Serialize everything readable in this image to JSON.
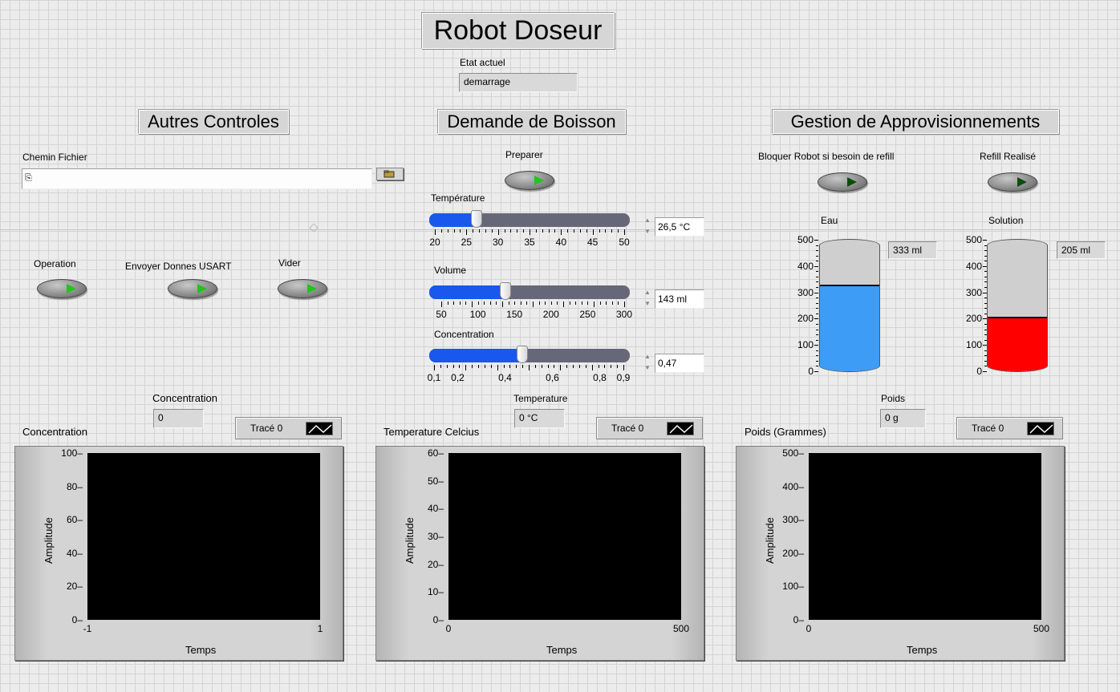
{
  "title": "Robot Doseur",
  "state": {
    "label": "Etat actuel",
    "value": "demarrage"
  },
  "sections": {
    "left": "Autres Controles",
    "center": "Demande de Boisson",
    "right": "Gestion de Approvisionnements"
  },
  "file": {
    "label": "Chemin Fichier",
    "value": "",
    "path_glyph": "⎘",
    "browse_icon": "folder-open-icon"
  },
  "buttons": {
    "operation": "Operation",
    "envoyer": "Envoyer Donnes USART",
    "vider": "Vider",
    "preparer": "Preparer",
    "bloquer": "Bloquer Robot si besoin de refill",
    "refill": "Refill Realisé"
  },
  "sliders": {
    "temperature": {
      "label": "Température",
      "value": 26.5,
      "min": 20,
      "max": 50,
      "display": "26,5 °C",
      "ticks": [
        "20",
        "25",
        "30",
        "35",
        "40",
        "45",
        "50"
      ]
    },
    "volume": {
      "label": "Volume",
      "value": 143,
      "min": 50,
      "max": 300,
      "display": "143 ml",
      "ticks": [
        "50",
        "100",
        "150",
        "200",
        "250",
        "300"
      ]
    },
    "concentration": {
      "label": "Concentration",
      "value": 0.47,
      "min": 0.1,
      "max": 0.9,
      "display": "0,47",
      "ticks": [
        "0,1",
        "0,2",
        "0,4",
        "0,6",
        "0,8",
        "0,9"
      ]
    }
  },
  "tanks": {
    "eau": {
      "label": "Eau",
      "value": 333,
      "display": "333 ml",
      "max": 500,
      "color": "#3d9cf5",
      "ticks": [
        "0",
        "100",
        "200",
        "300",
        "400",
        "500"
      ]
    },
    "solution": {
      "label": "Solution",
      "value": 205,
      "display": "205 ml",
      "max": 500,
      "color": "#ff0000",
      "ticks": [
        "0",
        "100",
        "200",
        "300",
        "400",
        "500"
      ]
    }
  },
  "indicators": {
    "concentration": {
      "label": "Concentration",
      "value": "0"
    },
    "temperature": {
      "label": "Temperature",
      "value": "0 °C"
    },
    "poids": {
      "label": "Poids",
      "value": "0 g"
    }
  },
  "graphs": [
    {
      "id": "concentration",
      "title": "Concentration",
      "legend": "Tracé 0",
      "ylabel": "Amplitude",
      "xlabel": "Temps",
      "yticks": [
        "100",
        "80",
        "60",
        "40",
        "20",
        "0"
      ],
      "xmin": "-1",
      "xmax": "1"
    },
    {
      "id": "temperature",
      "title": "Temperature Celcius",
      "legend": "Tracé 0",
      "ylabel": "Amplitude",
      "xlabel": "Temps",
      "yticks": [
        "60",
        "50",
        "40",
        "30",
        "20",
        "10",
        "0"
      ],
      "xmin": "0",
      "xmax": "500"
    },
    {
      "id": "poids",
      "title": "Poids (Grammes)",
      "legend": "Tracé 0",
      "ylabel": "Amplitude",
      "xlabel": "Temps",
      "yticks": [
        "500",
        "400",
        "300",
        "200",
        "100",
        "0"
      ],
      "xmin": "0",
      "xmax": "500"
    }
  ]
}
